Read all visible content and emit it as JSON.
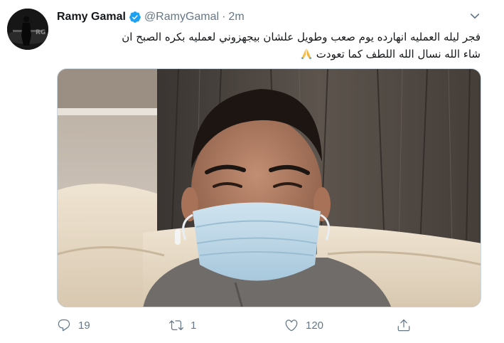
{
  "tweet": {
    "author_name": "Ramy Gamal",
    "handle": "@RamyGamal",
    "separator": "·",
    "time": "2m",
    "text_line1": "فجر ليله العمليه انهارده يوم صعب وطويل علشان بيجهزوني لعمليه بكره الصبح ان",
    "text_line2": "شاء الله نسال الله اللطف كما تعودت",
    "emoji": "folded-hands",
    "verified": true
  },
  "actions": {
    "reply_count": "19",
    "retweet_count": "1",
    "like_count": "120"
  },
  "icons": {
    "reply": "reply-icon",
    "retweet": "retweet-icon",
    "like": "heart-icon",
    "share": "share-icon",
    "more": "chevron-down-icon",
    "verified": "verified-badge-icon"
  },
  "colors": {
    "name": "#14171a",
    "muted": "#657786",
    "verified_blue": "#1da1f2"
  }
}
